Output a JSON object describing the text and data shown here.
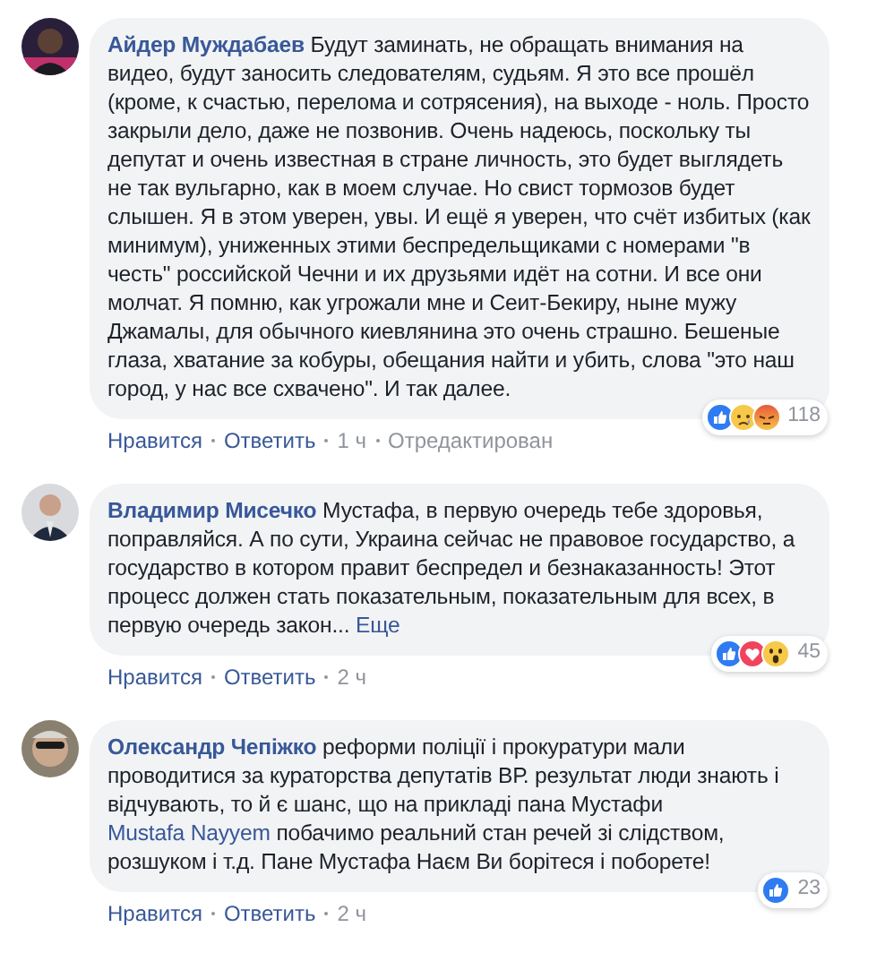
{
  "comments": [
    {
      "author": "Айдер Муждабаев",
      "avatar": {
        "kind": "picture"
      },
      "segments": [
        {
          "kind": "text",
          "text": "Будут заминать, не обращать внимания на видео, будут заносить следователям, судьям. Я это все прошёл (кроме, к счастью, перелома и сотрясения), на выходе - ноль. Просто закрыли дело, даже не позвонив. Очень надеюсь, поскольку ты депутат и очень известная в стране личность, это будет выглядеть не так вульгарно, как в моем случае. Но свист тормозов будет слышен. Я в этом уверен, увы. И ещё я уверен, что счёт избитых (как минимум), униженных этими беспредельщиками с номерами \"в честь\" российской Чечни и их друзьями идёт на сотни. И все они молчат. Я помню, как угрожали мне и Сеит-Бекиру, ныне мужу Джамалы, для обычного киевлянина это очень страшно. Бешеные глаза, хватание за кобуры, обещания найти и убить, слова \"это наш город, у нас все схвачено\". И так далее."
        }
      ],
      "reactions": [
        {
          "kind": "like"
        },
        {
          "kind": "sad"
        },
        {
          "kind": "angry"
        }
      ],
      "reaction_count": "118",
      "actions": [
        {
          "kind": "link",
          "text": "Нравится"
        },
        {
          "kind": "link",
          "text": "Ответить"
        },
        {
          "kind": "time",
          "text": "1 ч"
        },
        {
          "kind": "note",
          "text": "Отредактирован"
        }
      ]
    },
    {
      "author": "Владимир Мисечко",
      "avatar": {
        "kind": "picture"
      },
      "segments": [
        {
          "kind": "text",
          "text": "Мустафа, в первую очередь тебе здоровья, поправляйся. А по сути, Украина сейчас не правовое государство, а государство в котором правит беспредел и безнаказанность! Этот процесс должен стать показательным, показательным для всех, в первую очередь закон..."
        },
        {
          "kind": "link",
          "text": "Еще"
        }
      ],
      "reactions": [
        {
          "kind": "like"
        },
        {
          "kind": "love"
        },
        {
          "kind": "wow"
        }
      ],
      "reaction_count": "45",
      "actions": [
        {
          "kind": "link",
          "text": "Нравится"
        },
        {
          "kind": "link",
          "text": "Ответить"
        },
        {
          "kind": "time",
          "text": "2 ч"
        }
      ]
    },
    {
      "author": "Олександр Чепіжко",
      "avatar": {
        "kind": "picture"
      },
      "segments": [
        {
          "kind": "text",
          "text": "реформи поліції і прокуратури мали проводитися за кураторства депутатів ВР. результат люди знають і відчувають, то й є шанс, що на прикладі пана Мустафи"
        },
        {
          "kind": "link",
          "text": "Mustafa Nayyem"
        },
        {
          "kind": "text",
          "text": "побачимо реальний стан речей зі слідством, розшуком і т.д. Пане Мустафа Наєм Ви борітеся і поборете!"
        }
      ],
      "reactions": [
        {
          "kind": "like"
        }
      ],
      "reaction_count": "23",
      "actions": [
        {
          "kind": "link",
          "text": "Нравится"
        },
        {
          "kind": "link",
          "text": "Ответить"
        },
        {
          "kind": "time",
          "text": "2 ч"
        }
      ]
    }
  ]
}
